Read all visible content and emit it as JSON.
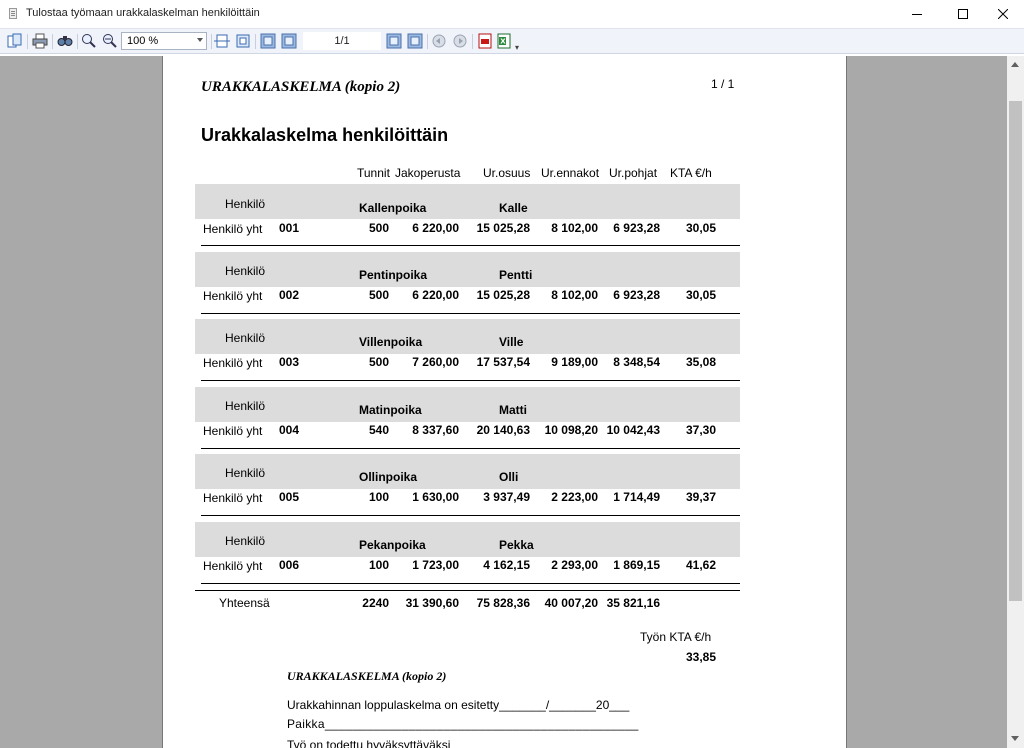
{
  "window": {
    "title": "Tulostaa työmaan urakkalaskelman henkilöittäin"
  },
  "toolbar": {
    "zoom": "100 %",
    "page_indicator": "1/1"
  },
  "report": {
    "header_title": "URAKKALASKELMA (kopio 2)",
    "page_number": "1 / 1",
    "main_title": "Urakkalaskelma henkilöittäin",
    "columns": {
      "tunnit": "Tunnit",
      "jakoperusta": "Jakoperusta",
      "urosuus": "Ur.osuus",
      "urennakot": "Ur.ennakot",
      "urpohjat": "Ur.pohjat",
      "kta": "KTA €/h"
    },
    "labels": {
      "henkilo": "Henkilö",
      "henkilo_yht": "Henkilö  yht"
    },
    "persons": [
      {
        "last": "Kallenpoika",
        "first": "Kalle",
        "id": "001",
        "tunnit": "500",
        "jakoperusta": "6 220,00",
        "urosuus": "15 025,28",
        "urennakot": "8 102,00",
        "urpohjat": "6 923,28",
        "kta": "30,05"
      },
      {
        "last": "Pentinpoika",
        "first": "Pentti",
        "id": "002",
        "tunnit": "500",
        "jakoperusta": "6 220,00",
        "urosuus": "15 025,28",
        "urennakot": "8 102,00",
        "urpohjat": "6 923,28",
        "kta": "30,05"
      },
      {
        "last": "Villenpoika",
        "first": "Ville",
        "id": "003",
        "tunnit": "500",
        "jakoperusta": "7 260,00",
        "urosuus": "17 537,54",
        "urennakot": "9 189,00",
        "urpohjat": "8 348,54",
        "kta": "35,08"
      },
      {
        "last": "Matinpoika",
        "first": "Matti",
        "id": "004",
        "tunnit": "540",
        "jakoperusta": "8 337,60",
        "urosuus": "20 140,63",
        "urennakot": "10 098,20",
        "urpohjat": "10 042,43",
        "kta": "37,30"
      },
      {
        "last": "Ollinpoika",
        "first": "Olli",
        "id": "005",
        "tunnit": "100",
        "jakoperusta": "1 630,00",
        "urosuus": "3 937,49",
        "urennakot": "2 223,00",
        "urpohjat": "1 714,49",
        "kta": "39,37"
      },
      {
        "last": "Pekanpoika",
        "first": "Pekka",
        "id": "006",
        "tunnit": "100",
        "jakoperusta": "1 723,00",
        "urosuus": "4 162,15",
        "urennakot": "2 293,00",
        "urpohjat": "1 869,15",
        "kta": "41,62"
      }
    ],
    "totals": {
      "label": "Yhteensä",
      "tunnit": "2240",
      "jakoperusta": "31 390,60",
      "urosuus": "75 828,36",
      "urennakot": "40 007,20",
      "urpohjat": "35 821,16"
    },
    "tyon_kta_label": "Työn KTA  €/h",
    "tyon_kta_value": "33,85",
    "footer_title": "URAKKALASKELMA (kopio 2)",
    "footer_line1": "Urakkahinnan loppulaskelma on esitetty_______/_______20___",
    "footer_line2": "Paikka_____________________________________________",
    "footer_line3": "Työ on todettu hyväksyttäväksi"
  }
}
